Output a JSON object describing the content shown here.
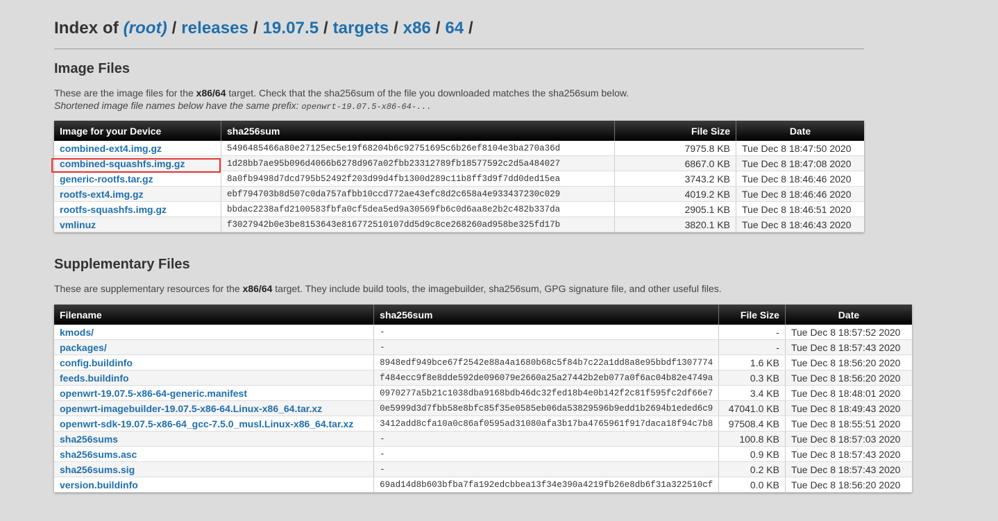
{
  "header": {
    "index_of": "Index of",
    "breadcrumbs": [
      {
        "label": "(root)"
      },
      {
        "label": "releases"
      },
      {
        "label": "19.07.5"
      },
      {
        "label": "targets"
      },
      {
        "label": "x86"
      },
      {
        "label": "64"
      }
    ],
    "separator": "/"
  },
  "image_files": {
    "heading": "Image Files",
    "desc_pre": "These are the image files for the ",
    "desc_target": "x86/64",
    "desc_post": " target. Check that the sha256sum of the file you downloaded matches the sha256sum below.",
    "prefix_note": "Shortened image file names below have the same prefix: ",
    "prefix_value": "openwrt-19.07.5-x86-64-...",
    "columns": [
      "Image for your Device",
      "sha256sum",
      "File Size",
      "Date"
    ],
    "rows": [
      {
        "name": "combined-ext4.img.gz",
        "sha": "5496485466a80e27125ec5e19f68204b6c92751695c6b26ef8104e3ba270a36d",
        "size": "7975.8 KB",
        "date": "Tue Dec 8 18:47:50 2020"
      },
      {
        "name": "combined-squashfs.img.gz",
        "sha": "1d28bb7ae95b096d4066b6278d967a02fbb23312789fb18577592c2d5a484027",
        "size": "6867.0 KB",
        "date": "Tue Dec 8 18:47:08 2020"
      },
      {
        "name": "generic-rootfs.tar.gz",
        "sha": "8a0fb9498d7dcd795b52492f203d99d4fb1300d289c11b8ff3d9f7dd0ded15ea",
        "size": "3743.2 KB",
        "date": "Tue Dec 8 18:46:46 2020"
      },
      {
        "name": "rootfs-ext4.img.gz",
        "sha": "ebf794703b8d507c0da757afbb10ccd772ae43efc8d2c658a4e933437230c029",
        "size": "4019.2 KB",
        "date": "Tue Dec 8 18:46:46 2020"
      },
      {
        "name": "rootfs-squashfs.img.gz",
        "sha": "bbdac2238afd2100583fbfa0cf5dea5ed9a30569fb6c0d6aa8e2b2c482b337da",
        "size": "2905.1 KB",
        "date": "Tue Dec 8 18:46:51 2020"
      },
      {
        "name": "vmlinuz",
        "sha": "f3027942b0e3be8153643e816772510107dd5d9c8ce268260ad958be325fd17b",
        "size": "3820.1 KB",
        "date": "Tue Dec 8 18:46:43 2020"
      }
    ]
  },
  "supplementary_files": {
    "heading": "Supplementary Files",
    "desc_pre": "These are supplementary resources for the ",
    "desc_target": "x86/64",
    "desc_post": " target. They include build tools, the imagebuilder, sha256sum, GPG signature file, and other useful files.",
    "columns": [
      "Filename",
      "sha256sum",
      "File Size",
      "Date"
    ],
    "rows": [
      {
        "name": "kmods/",
        "sha": "-",
        "size": "-",
        "date": "Tue Dec 8 18:57:52 2020"
      },
      {
        "name": "packages/",
        "sha": "-",
        "size": "-",
        "date": "Tue Dec 8 18:57:43 2020"
      },
      {
        "name": "config.buildinfo",
        "sha": "8948edf949bce67f2542e88a4a1680b68c5f84b7c22a1dd8a8e95bbdf1307774",
        "size": "1.6 KB",
        "date": "Tue Dec 8 18:56:20 2020"
      },
      {
        "name": "feeds.buildinfo",
        "sha": "f484ecc9f8e8dde592de096079e2660a25a27442b2eb077a0f6ac04b82e4749a",
        "size": "0.3 KB",
        "date": "Tue Dec 8 18:56:20 2020"
      },
      {
        "name": "openwrt-19.07.5-x86-64-generic.manifest",
        "sha": "0970277a5b21c1038dba9168bdb46dc32fed18b4e0b142f2c81f595fc2df66e7",
        "size": "3.4 KB",
        "date": "Tue Dec 8 18:48:01 2020"
      },
      {
        "name": "openwrt-imagebuilder-19.07.5-x86-64.Linux-x86_64.tar.xz",
        "sha": "0e5999d3d7fbb58e8bfc85f35e0585eb06da53829596b9edd1b2694b1eded6c9",
        "size": "47041.0 KB",
        "date": "Tue Dec 8 18:49:43 2020"
      },
      {
        "name": "openwrt-sdk-19.07.5-x86-64_gcc-7.5.0_musl.Linux-x86_64.tar.xz",
        "sha": "3412add8cfa10a0c86af0595ad31080afa3b17ba4765961f917daca18f94c7b8",
        "size": "97508.4 KB",
        "date": "Tue Dec 8 18:55:51 2020"
      },
      {
        "name": "sha256sums",
        "sha": "-",
        "size": "100.8 KB",
        "date": "Tue Dec 8 18:57:03 2020"
      },
      {
        "name": "sha256sums.asc",
        "sha": "-",
        "size": "0.9 KB",
        "date": "Tue Dec 8 18:57:43 2020"
      },
      {
        "name": "sha256sums.sig",
        "sha": "-",
        "size": "0.2 KB",
        "date": "Tue Dec 8 18:57:43 2020"
      },
      {
        "name": "version.buildinfo",
        "sha": "69ad14d8b603bfba7fa192edcbbea13f34e390a4219fb26e8db6f31a322510cf",
        "size": "0.0 KB",
        "date": "Tue Dec 8 18:56:20 2020"
      }
    ]
  },
  "colors": {
    "background": "#dcdcdc",
    "link": "#1f6fad",
    "highlight_box": "#e53935"
  }
}
